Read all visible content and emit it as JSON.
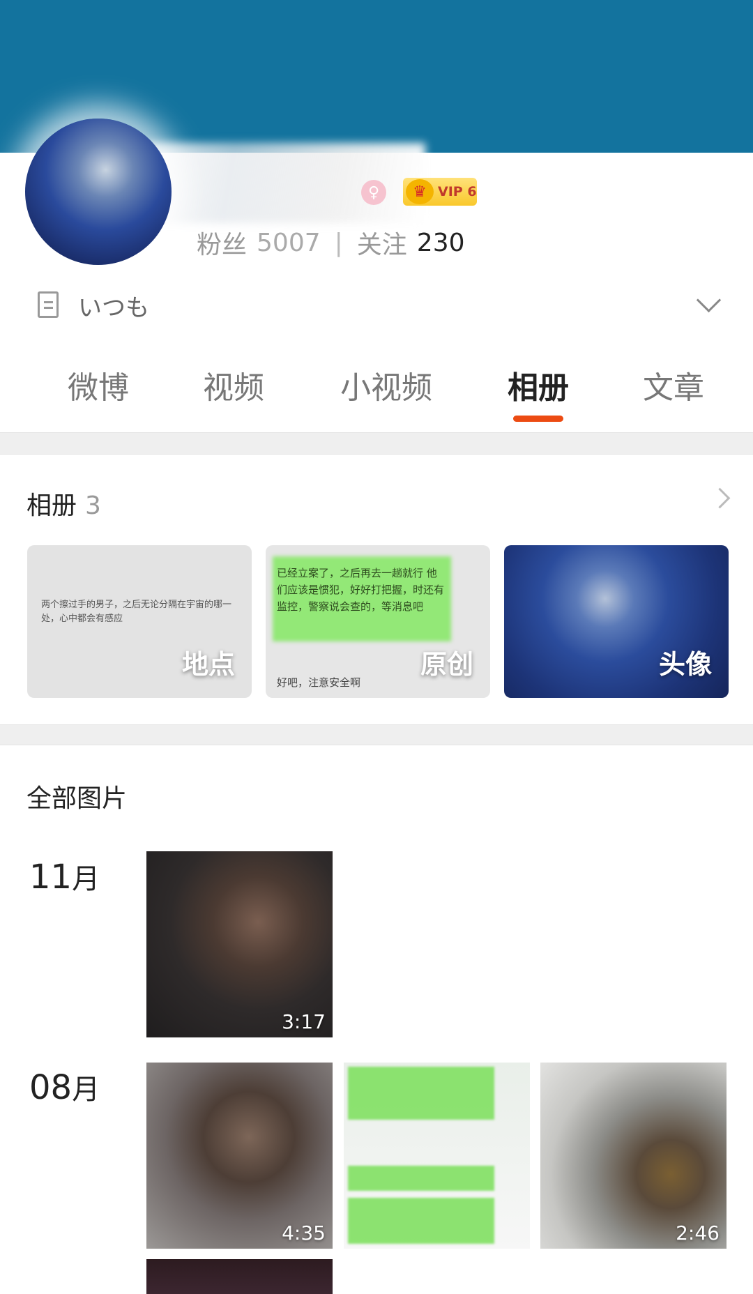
{
  "profile": {
    "stats_followers_label": "粉丝",
    "stats_followers_value": "5007",
    "stats_separator": "|",
    "stats_following_label": "关注",
    "stats_following_value": "230",
    "vip_label": "VIP 6",
    "bio": "いつも"
  },
  "tabs": [
    {
      "label": "微博"
    },
    {
      "label": "视频"
    },
    {
      "label": "小视频"
    },
    {
      "label": "相册",
      "active": true
    },
    {
      "label": "文章"
    }
  ],
  "albums": {
    "title": "相册",
    "count": "3",
    "items": [
      {
        "label": "地点",
        "snippet": "两个擦过手的男子，之后无论分隔在宇宙的哪一处，心中都会有感应"
      },
      {
        "label": "原创",
        "snippet": "已经立案了，之后再去一趟就行 他们应该是惯犯，好好打把握，时还有监控，警察说会查的，等消息吧",
        "footer": "好吧，注意安全啊"
      },
      {
        "label": "头像"
      }
    ]
  },
  "photos": {
    "title": "全部图片",
    "groups": [
      {
        "month": "11",
        "month_suffix": "月",
        "durations": [
          "3:17"
        ]
      },
      {
        "month": "08",
        "month_suffix": "月",
        "durations": [
          "4:35",
          "2:46"
        ]
      }
    ]
  },
  "colors": {
    "banner": "#13739e",
    "accent": "#ec4b12",
    "vip": "#f9c82c"
  }
}
